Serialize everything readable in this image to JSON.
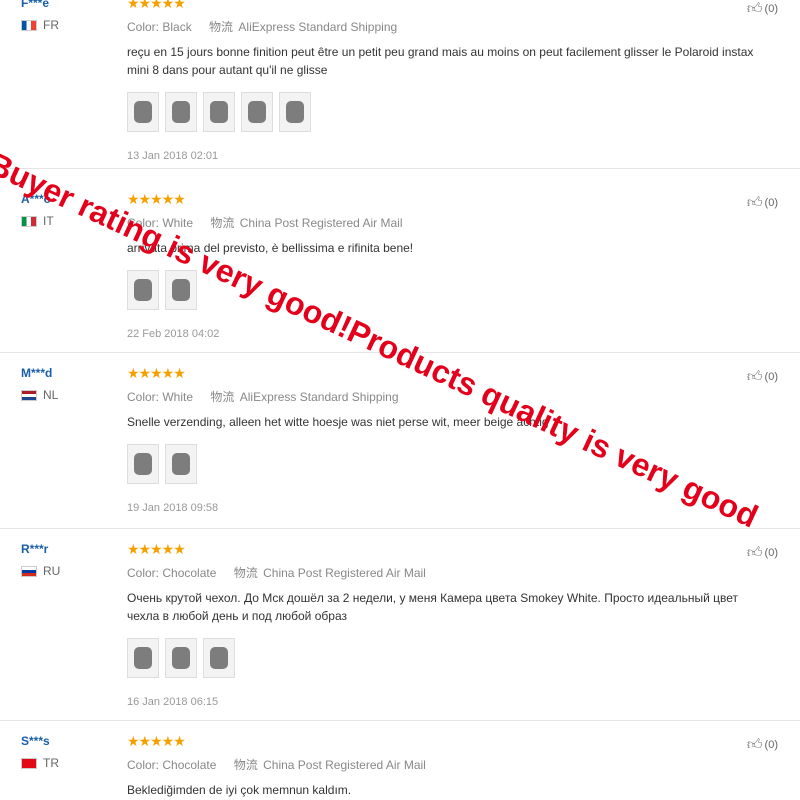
{
  "like_icon": "thumbs-up-icon",
  "ship_icon_text": "物流",
  "color_label": "Color:",
  "stars": "★★★★★",
  "reviews": [
    {
      "user": "F***e",
      "country": "FR",
      "color": "Black",
      "shipping": "AliExpress Standard Shipping",
      "text": "reçu en 15 jours bonne finition peut être un petit peu grand mais au moins on peut facilement glisser le Polaroid instax mini 8 dans pour autant qu'il ne glisse",
      "photos": 5,
      "date": "13 Jan 2018 02:01",
      "likes": "(0)"
    },
    {
      "user": "A***o",
      "country": "IT",
      "color": "White",
      "shipping": "China Post Registered Air Mail",
      "text": "arrivata prima del previsto, è bellissima e rifinita bene!",
      "photos": 2,
      "date": "22 Feb 2018 04:02",
      "likes": "(0)"
    },
    {
      "user": "M***d",
      "country": "NL",
      "color": "White",
      "shipping": "AliExpress Standard Shipping",
      "text": "Snelle verzending, alleen het witte hoesje was niet perse wit, meer beige achtig",
      "photos": 2,
      "date": "19 Jan 2018 09:58",
      "likes": "(0)"
    },
    {
      "user": "R***r",
      "country": "RU",
      "color": "Chocolate",
      "shipping": "China Post Registered Air Mail",
      "text": "Очень крутой чехол. До Мск дошёл за 2 недели, у меня Камера цвета Smokey White. Просто идеальный цвет чехла в любой день и под любой образ",
      "photos": 3,
      "date": "16 Jan 2018 06:15",
      "likes": "(0)"
    },
    {
      "user": "S***s",
      "country": "TR",
      "color": "Chocolate",
      "shipping": "China Post Registered Air Mail",
      "text": "Beklediğimden de iyi çok memnun kaldım.",
      "photos": 0,
      "date": "",
      "likes": "(0)"
    }
  ],
  "overlay_text": "Buyer rating is very good!Products quality is very good"
}
